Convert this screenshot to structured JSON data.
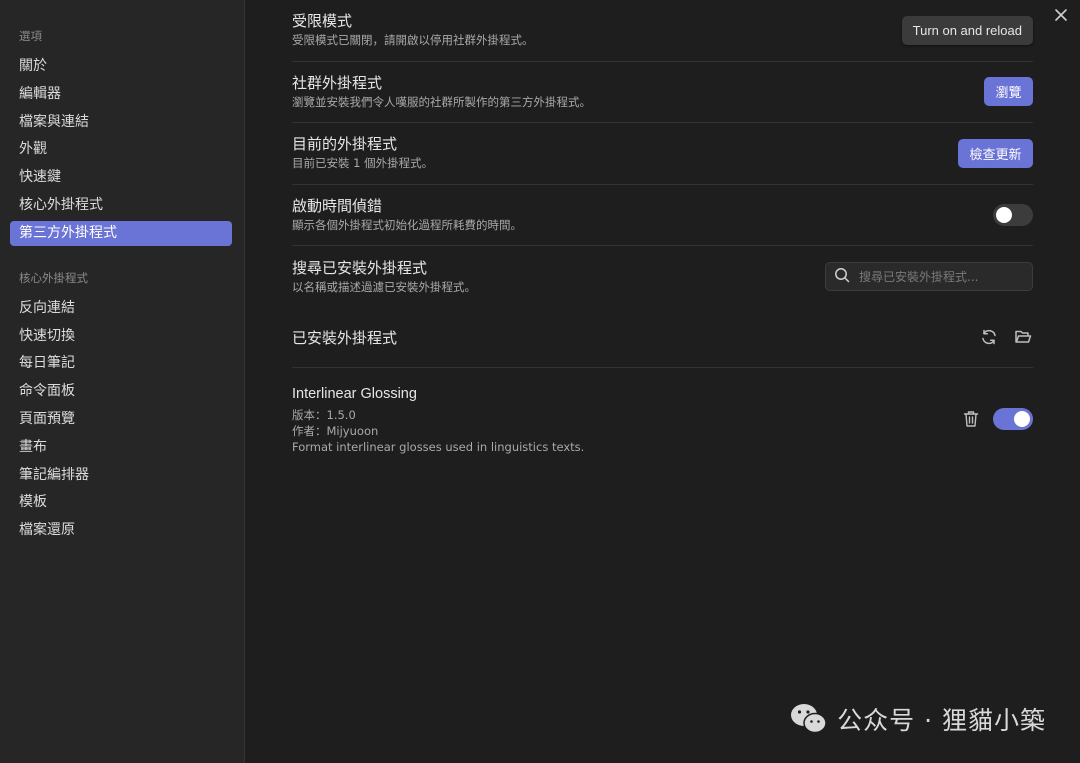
{
  "sidebar": {
    "group1_title": "選項",
    "group1_items": [
      {
        "label": "關於"
      },
      {
        "label": "編輯器"
      },
      {
        "label": "檔案與連結"
      },
      {
        "label": "外觀"
      },
      {
        "label": "快速鍵"
      },
      {
        "label": "核心外掛程式"
      },
      {
        "label": "第三方外掛程式",
        "active": true
      }
    ],
    "group2_title": "核心外掛程式",
    "group2_items": [
      {
        "label": "反向連結"
      },
      {
        "label": "快速切換"
      },
      {
        "label": "每日筆記"
      },
      {
        "label": "命令面板"
      },
      {
        "label": "頁面預覽"
      },
      {
        "label": "畫布"
      },
      {
        "label": "筆記編排器"
      },
      {
        "label": "模板"
      },
      {
        "label": "檔案還原"
      }
    ]
  },
  "settings": {
    "restricted": {
      "name": "受限模式",
      "desc": "受限模式已關閉，請開啟以停用社群外掛程式。",
      "button": "Turn on and reload"
    },
    "community": {
      "name": "社群外掛程式",
      "desc": "瀏覽並安裝我們令人嘆服的社群所製作的第三方外掛程式。",
      "button": "瀏覽"
    },
    "current": {
      "name": "目前的外掛程式",
      "desc": "目前已安裝 1 個外掛程式。",
      "button": "檢查更新"
    },
    "debug": {
      "name": "啟動時間偵錯",
      "desc": "顯示各個外掛程式初始化過程所耗費的時間。",
      "toggle_on": false
    },
    "search": {
      "name": "搜尋已安裝外掛程式",
      "desc": "以名稱或描述過濾已安裝外掛程式。",
      "placeholder": "搜尋已安裝外掛程式..."
    }
  },
  "installed": {
    "title": "已安裝外掛程式",
    "plugins": [
      {
        "name": "Interlinear Glossing",
        "version": "版本：1.5.0",
        "author": "作者：Mijyuoon",
        "description": "Format interlinear glosses used in linguistics texts.",
        "enabled": true
      }
    ]
  },
  "watermark": {
    "text": "公众号 · 狸貓小築"
  },
  "colors": {
    "accent": "#6a73d6",
    "background": "#1e1e1e",
    "sidebar": "#262626"
  }
}
